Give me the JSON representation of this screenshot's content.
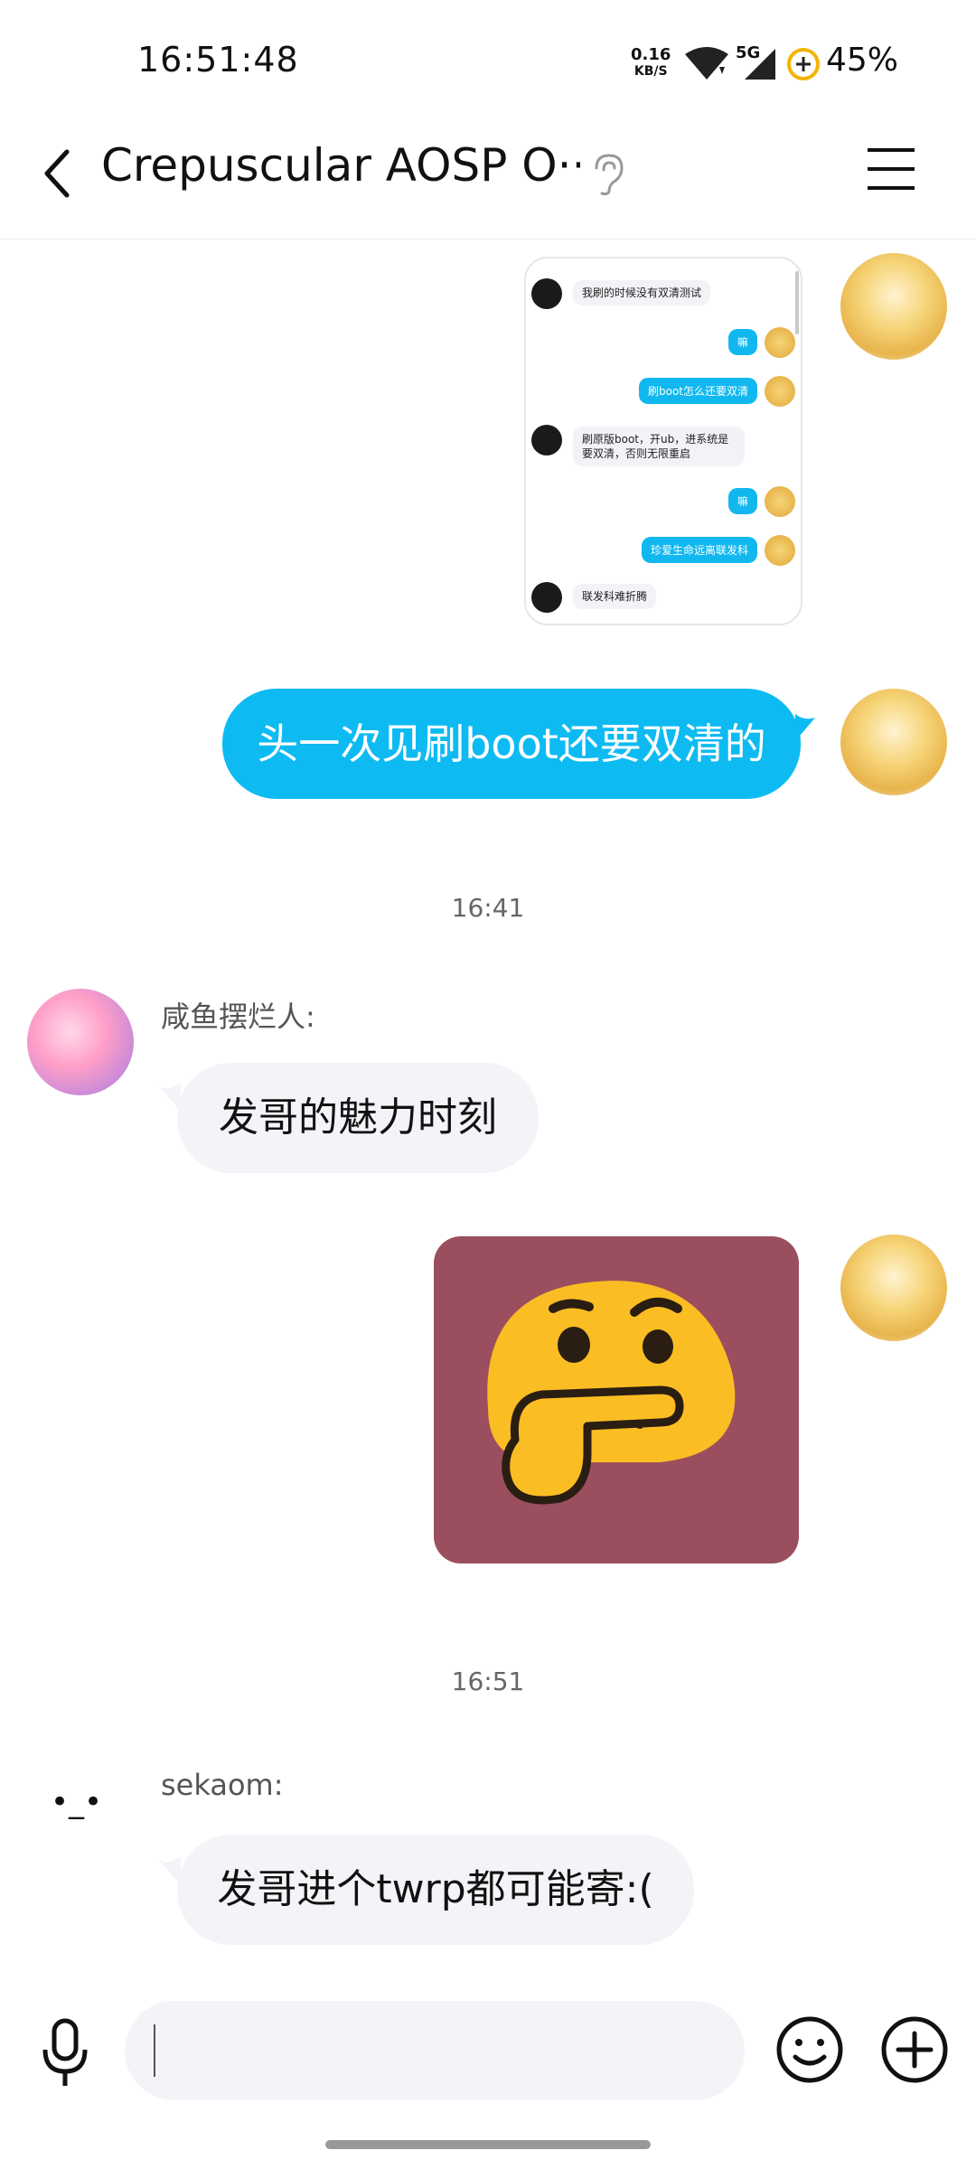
{
  "status_bar": {
    "time": "16:51:48",
    "net_speed_value": "0.16",
    "net_speed_unit": "KB/S",
    "network_type": "5G",
    "battery": "45%"
  },
  "header": {
    "title": "Crepuscular AOSP O···"
  },
  "thumbnail_messages": [
    {
      "side": "left",
      "text": "我刷的时候没有双清测试"
    },
    {
      "side": "right",
      "text": "嘛"
    },
    {
      "side": "right",
      "text": "刷boot怎么还要双清"
    },
    {
      "side": "left",
      "text": "刷原版boot，开ub，进系统是要双清，否则无限重启"
    },
    {
      "side": "right",
      "text": "嘛"
    },
    {
      "side": "right",
      "text": "珍爱生命远离联发科"
    },
    {
      "side": "left",
      "text": "联发科难折腾"
    }
  ],
  "messages": {
    "self_1": "头一次见刷boot还要双清的",
    "time_1": "16:41",
    "sender_1": "咸鱼摆烂人:",
    "msg_1": "发哥的魅力时刻",
    "time_2": "16:51",
    "sender_2": "sekaom:",
    "sender_2_avatar": "•_•",
    "msg_2": "发哥进个twrp都可能寄:("
  },
  "input": {
    "placeholder": ""
  },
  "colors": {
    "accent_blue": "#0dbbf2",
    "bubble_gray": "#f3f4f8",
    "sticker_bg": "#9b4f5e",
    "thinking_face": "#fbbd24"
  }
}
